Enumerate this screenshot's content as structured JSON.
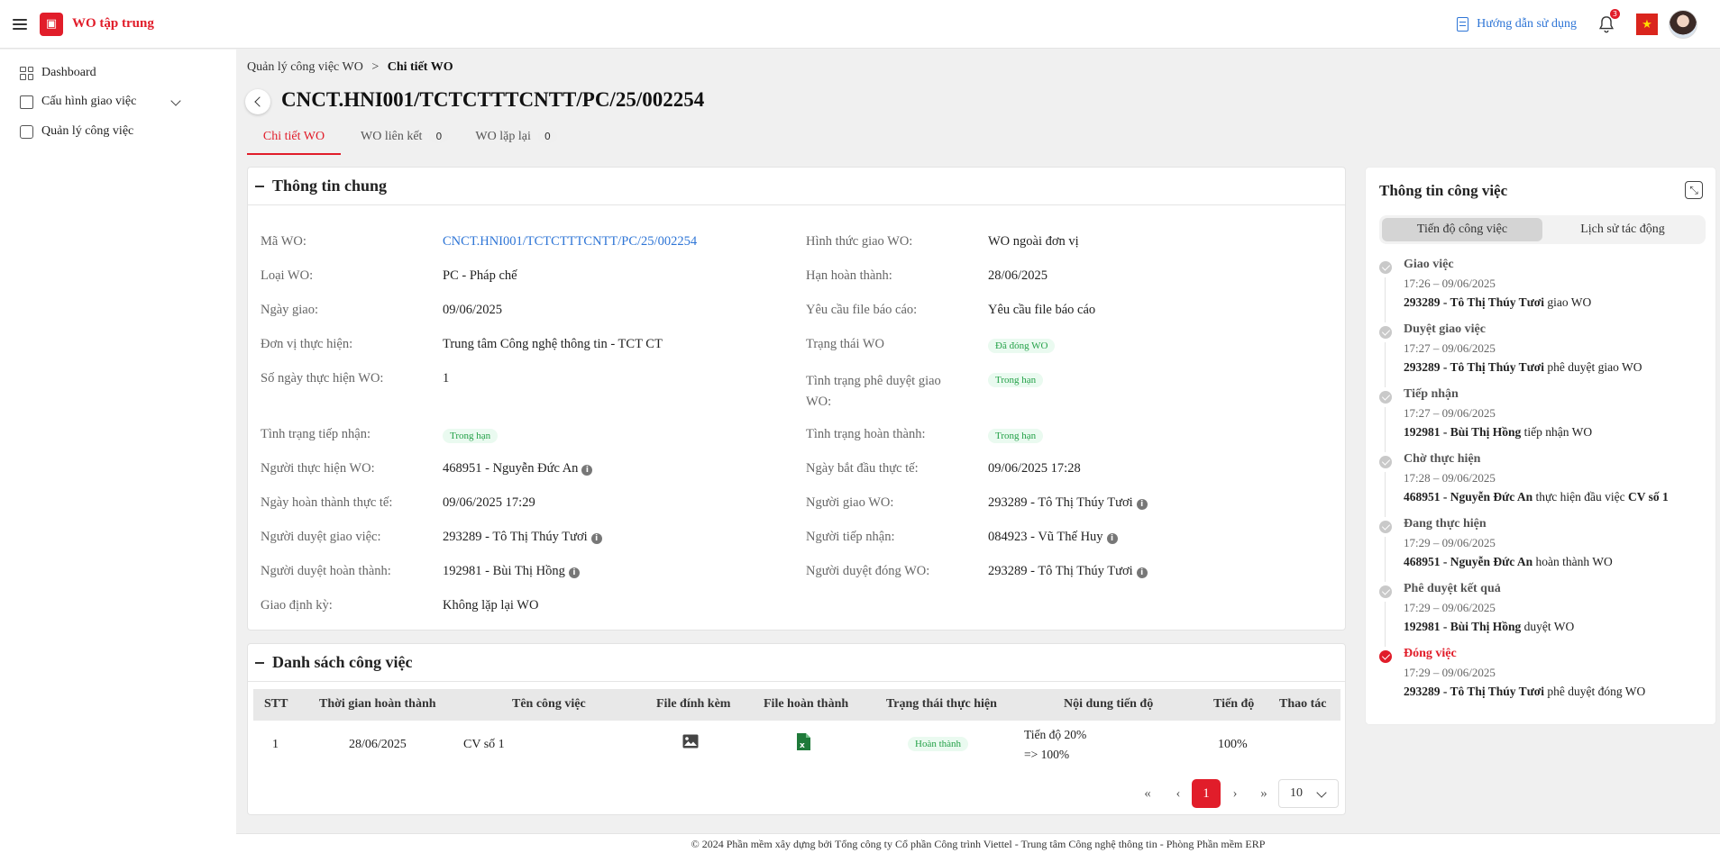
{
  "header": {
    "app_title": "WO tập trung",
    "guide_label": "Hướng dẫn sử dụng",
    "notification_count": "3"
  },
  "sidebar": {
    "items": [
      {
        "label": "Dashboard"
      },
      {
        "label": "Cấu hình giao việc"
      },
      {
        "label": "Quản lý công việc"
      }
    ]
  },
  "breadcrumb": {
    "parent": "Quản lý công việc WO",
    "separator": ">",
    "current": "Chi tiết WO"
  },
  "page_title": "CNCT.HNI001/TCTCTTTCNTT/PC/25/002254",
  "tabs": [
    {
      "label": "Chi tiết WO"
    },
    {
      "label": "WO liên kết",
      "count": "0"
    },
    {
      "label": "WO lặp lại",
      "count": "0"
    }
  ],
  "general": {
    "title": "Thông tin chung",
    "left": [
      {
        "label": "Mã WO:",
        "value": "CNCT.HNI001/TCTCTTTCNTT/PC/25/002254"
      },
      {
        "label": "Loại WO:",
        "value": "PC - Pháp chế"
      },
      {
        "label": "Ngày giao:",
        "value": "09/06/2025"
      },
      {
        "label": "Đơn vị thực hiện:",
        "value": "Trung tâm Công nghệ thông tin - TCT CT"
      },
      {
        "label": "Số ngày thực hiện WO:",
        "value": "1"
      },
      {
        "label": "Tình trạng tiếp nhận:",
        "value": "Trong hạn"
      },
      {
        "label": "Người thực hiện WO:",
        "value": "468951 - Nguyễn Đức An"
      },
      {
        "label": "Ngày hoàn thành thực tế:",
        "value": "09/06/2025 17:29"
      },
      {
        "label": "Người duyệt giao việc:",
        "value": "293289 - Tô Thị Thúy Tươi"
      },
      {
        "label": "Người duyệt hoàn thành:",
        "value": "192981 - Bùi Thị Hồng"
      },
      {
        "label": "Giao định kỳ:",
        "value": "Không lặp lại WO"
      }
    ],
    "right": [
      {
        "label": "Hình thức giao WO:",
        "value": "WO ngoài đơn vị"
      },
      {
        "label": "Hạn hoàn thành:",
        "value": "28/06/2025"
      },
      {
        "label": "Yêu cầu file báo cáo:",
        "value": "Yêu cầu file báo cáo"
      },
      {
        "label": "Trạng thái WO",
        "value": "Đã đóng WO"
      },
      {
        "label": "Tình trạng phê duyệt giao WO:",
        "value": "Trong hạn"
      },
      {
        "label": "Tình trạng hoàn thành:",
        "value": "Trong hạn"
      },
      {
        "label": "Ngày bắt đầu thực tế:",
        "value": "09/06/2025 17:28"
      },
      {
        "label": "Người giao WO:",
        "value": "293289 - Tô Thị Thúy Tươi"
      },
      {
        "label": "Người tiếp nhận:",
        "value": "084923 - Vũ Thế Huy"
      },
      {
        "label": "Người duyệt đóng WO:",
        "value": "293289 - Tô Thị Thúy Tươi"
      }
    ]
  },
  "tasks": {
    "title": "Danh sách công việc",
    "columns": [
      "STT",
      "Thời gian hoàn thành",
      "Tên công việc",
      "File đính kèm",
      "File hoàn thành",
      "Trạng thái thực hiện",
      "Nội dung tiến độ",
      "Tiến độ",
      "Thao tác"
    ],
    "rows": [
      {
        "stt": "1",
        "deadline": "28/06/2025",
        "name": "CV số 1",
        "status": "Hoàn thành",
        "progress_note_1": "Tiến độ 20%",
        "progress_note_2": "=> 100%",
        "progress": "100%"
      }
    ],
    "pagination": {
      "first": "«",
      "prev": "‹",
      "current": "1",
      "next": "›",
      "last": "»",
      "page_size": "10"
    }
  },
  "work_info": {
    "title": "Thông tin công việc",
    "tabs": [
      "Tiến độ công việc",
      "Lịch sử tác động"
    ],
    "timeline": [
      {
        "title": "Giao việc",
        "time": "17:26 – 09/06/2025",
        "actor": "293289 - Tô Thị Thúy Tươi",
        "action": " giao WO"
      },
      {
        "title": "Duyệt giao việc",
        "time": "17:27 – 09/06/2025",
        "actor": "293289 - Tô Thị Thúy Tươi",
        "action": " phê duyệt giao WO"
      },
      {
        "title": "Tiếp nhận",
        "time": "17:27 – 09/06/2025",
        "actor": "192981 - Bùi Thị Hồng",
        "action": " tiếp nhận WO"
      },
      {
        "title": "Chờ thực hiện",
        "time": "17:28 – 09/06/2025",
        "actor": "468951 - Nguyễn Đức An",
        "action": " thực hiện đầu việc ",
        "extra": "CV số 1"
      },
      {
        "title": "Đang thực hiện",
        "time": "17:29 – 09/06/2025",
        "actor": "468951 - Nguyễn Đức An",
        "action": " hoàn thành WO"
      },
      {
        "title": "Phê duyệt kết quả",
        "time": "17:29 – 09/06/2025",
        "actor": "192981 - Bùi Thị Hồng",
        "action": " duyệt WO"
      },
      {
        "title": "Đóng việc",
        "time": "17:29 – 09/06/2025",
        "actor": "293289 - Tô Thị Thúy Tươi",
        "action": " phê duyệt đóng WO"
      }
    ]
  },
  "footer": "© 2024 Phần mềm xây dựng bởi Tổng công ty Cổ phần Công trình Viettel - Trung tâm Công nghệ thông tin - Phòng Phần mềm ERP",
  "colors": {
    "brand": "#e11d2a",
    "link": "#2e75d6",
    "success_text": "#24a148",
    "success_bg": "#eafaf0"
  }
}
